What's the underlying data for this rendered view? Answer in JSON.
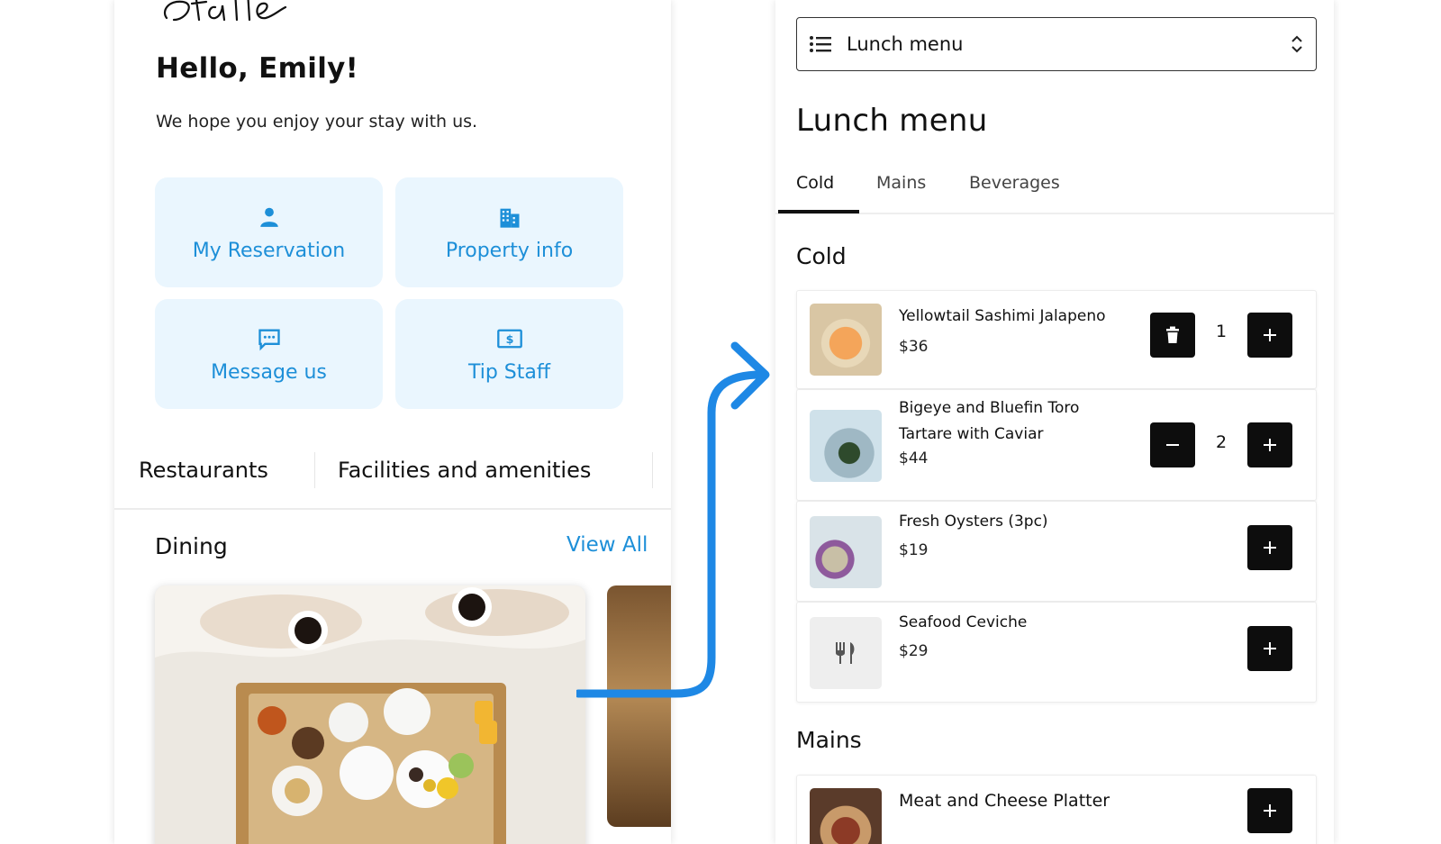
{
  "left": {
    "greeting": "Hello, Emily!",
    "subtitle": "We hope you enjoy your stay with us.",
    "tiles": [
      {
        "label": "My Reservation",
        "icon": "person-icon"
      },
      {
        "label": "Property info",
        "icon": "building-icon"
      },
      {
        "label": "Message us",
        "icon": "chat-icon"
      },
      {
        "label": "Tip Staff",
        "icon": "dollar-bill-icon"
      }
    ],
    "categories": [
      "Restaurants",
      "Facilities and amenities"
    ],
    "dining": {
      "title": "Dining",
      "view_all": "View All"
    }
  },
  "right": {
    "menu_select": {
      "value": "Lunch menu"
    },
    "menu_title": "Lunch menu",
    "tabs": [
      "Cold",
      "Mains",
      "Beverages"
    ],
    "active_tab": "Cold",
    "sections": {
      "cold": "Cold",
      "mains": "Mains"
    },
    "items": [
      {
        "name": "Yellowtail Sashimi Jalapeno",
        "price": "$36",
        "quantity": "1"
      },
      {
        "name": "Bigeye and Bluefin Toro Tartare with Caviar",
        "price": "$44",
        "quantity": "2"
      },
      {
        "name": "Fresh Oysters (3pc)",
        "price": "$19"
      },
      {
        "name": "Seafood Ceviche",
        "price": "$29"
      },
      {
        "name": "Meat and Cheese Platter"
      }
    ]
  },
  "colors": {
    "accent": "#1d8fd8",
    "tile_background": "#eaf6fe",
    "arrow": "#1e88e5",
    "button": "#0d0d0d"
  }
}
